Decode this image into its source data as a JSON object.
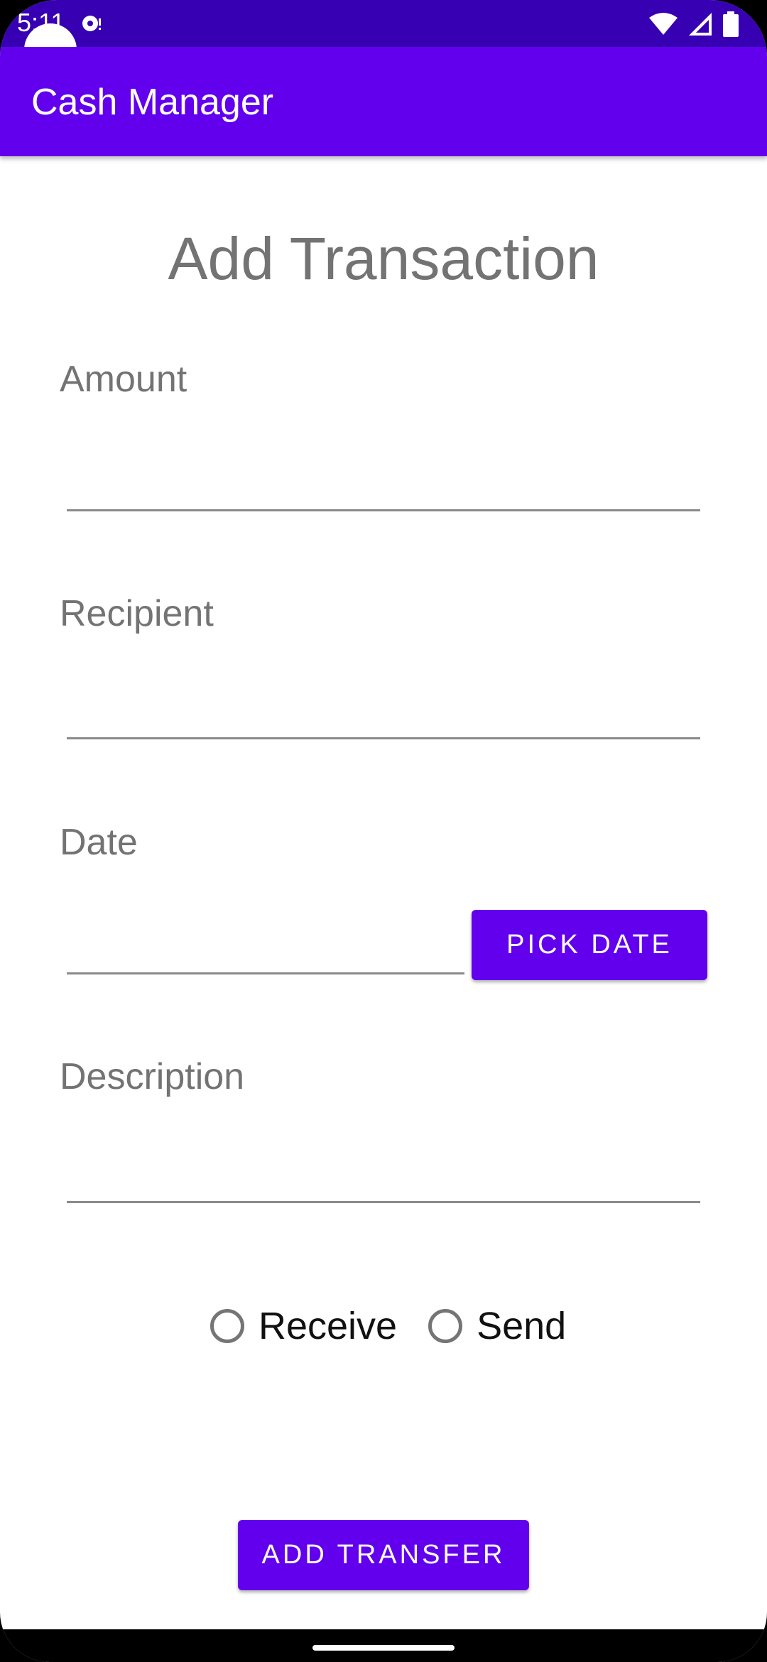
{
  "status_bar": {
    "time": "5:11",
    "colors": {
      "background": "#3700b3"
    },
    "icons": [
      "notification-icon",
      "wifi-icon",
      "signal-icon",
      "battery-icon"
    ]
  },
  "app_bar": {
    "title": "Cash Manager",
    "color": "#6200ee"
  },
  "form": {
    "heading": "Add Transaction",
    "amount_label": "Amount",
    "amount_value": "",
    "recipient_label": "Recipient",
    "recipient_value": "",
    "date_label": "Date",
    "date_value": "",
    "pick_date_button": "PICK DATE",
    "description_label": "Description",
    "description_value": "",
    "radio_receive": "Receive",
    "radio_send": "Send",
    "submit_button": "ADD TRANSFER"
  }
}
